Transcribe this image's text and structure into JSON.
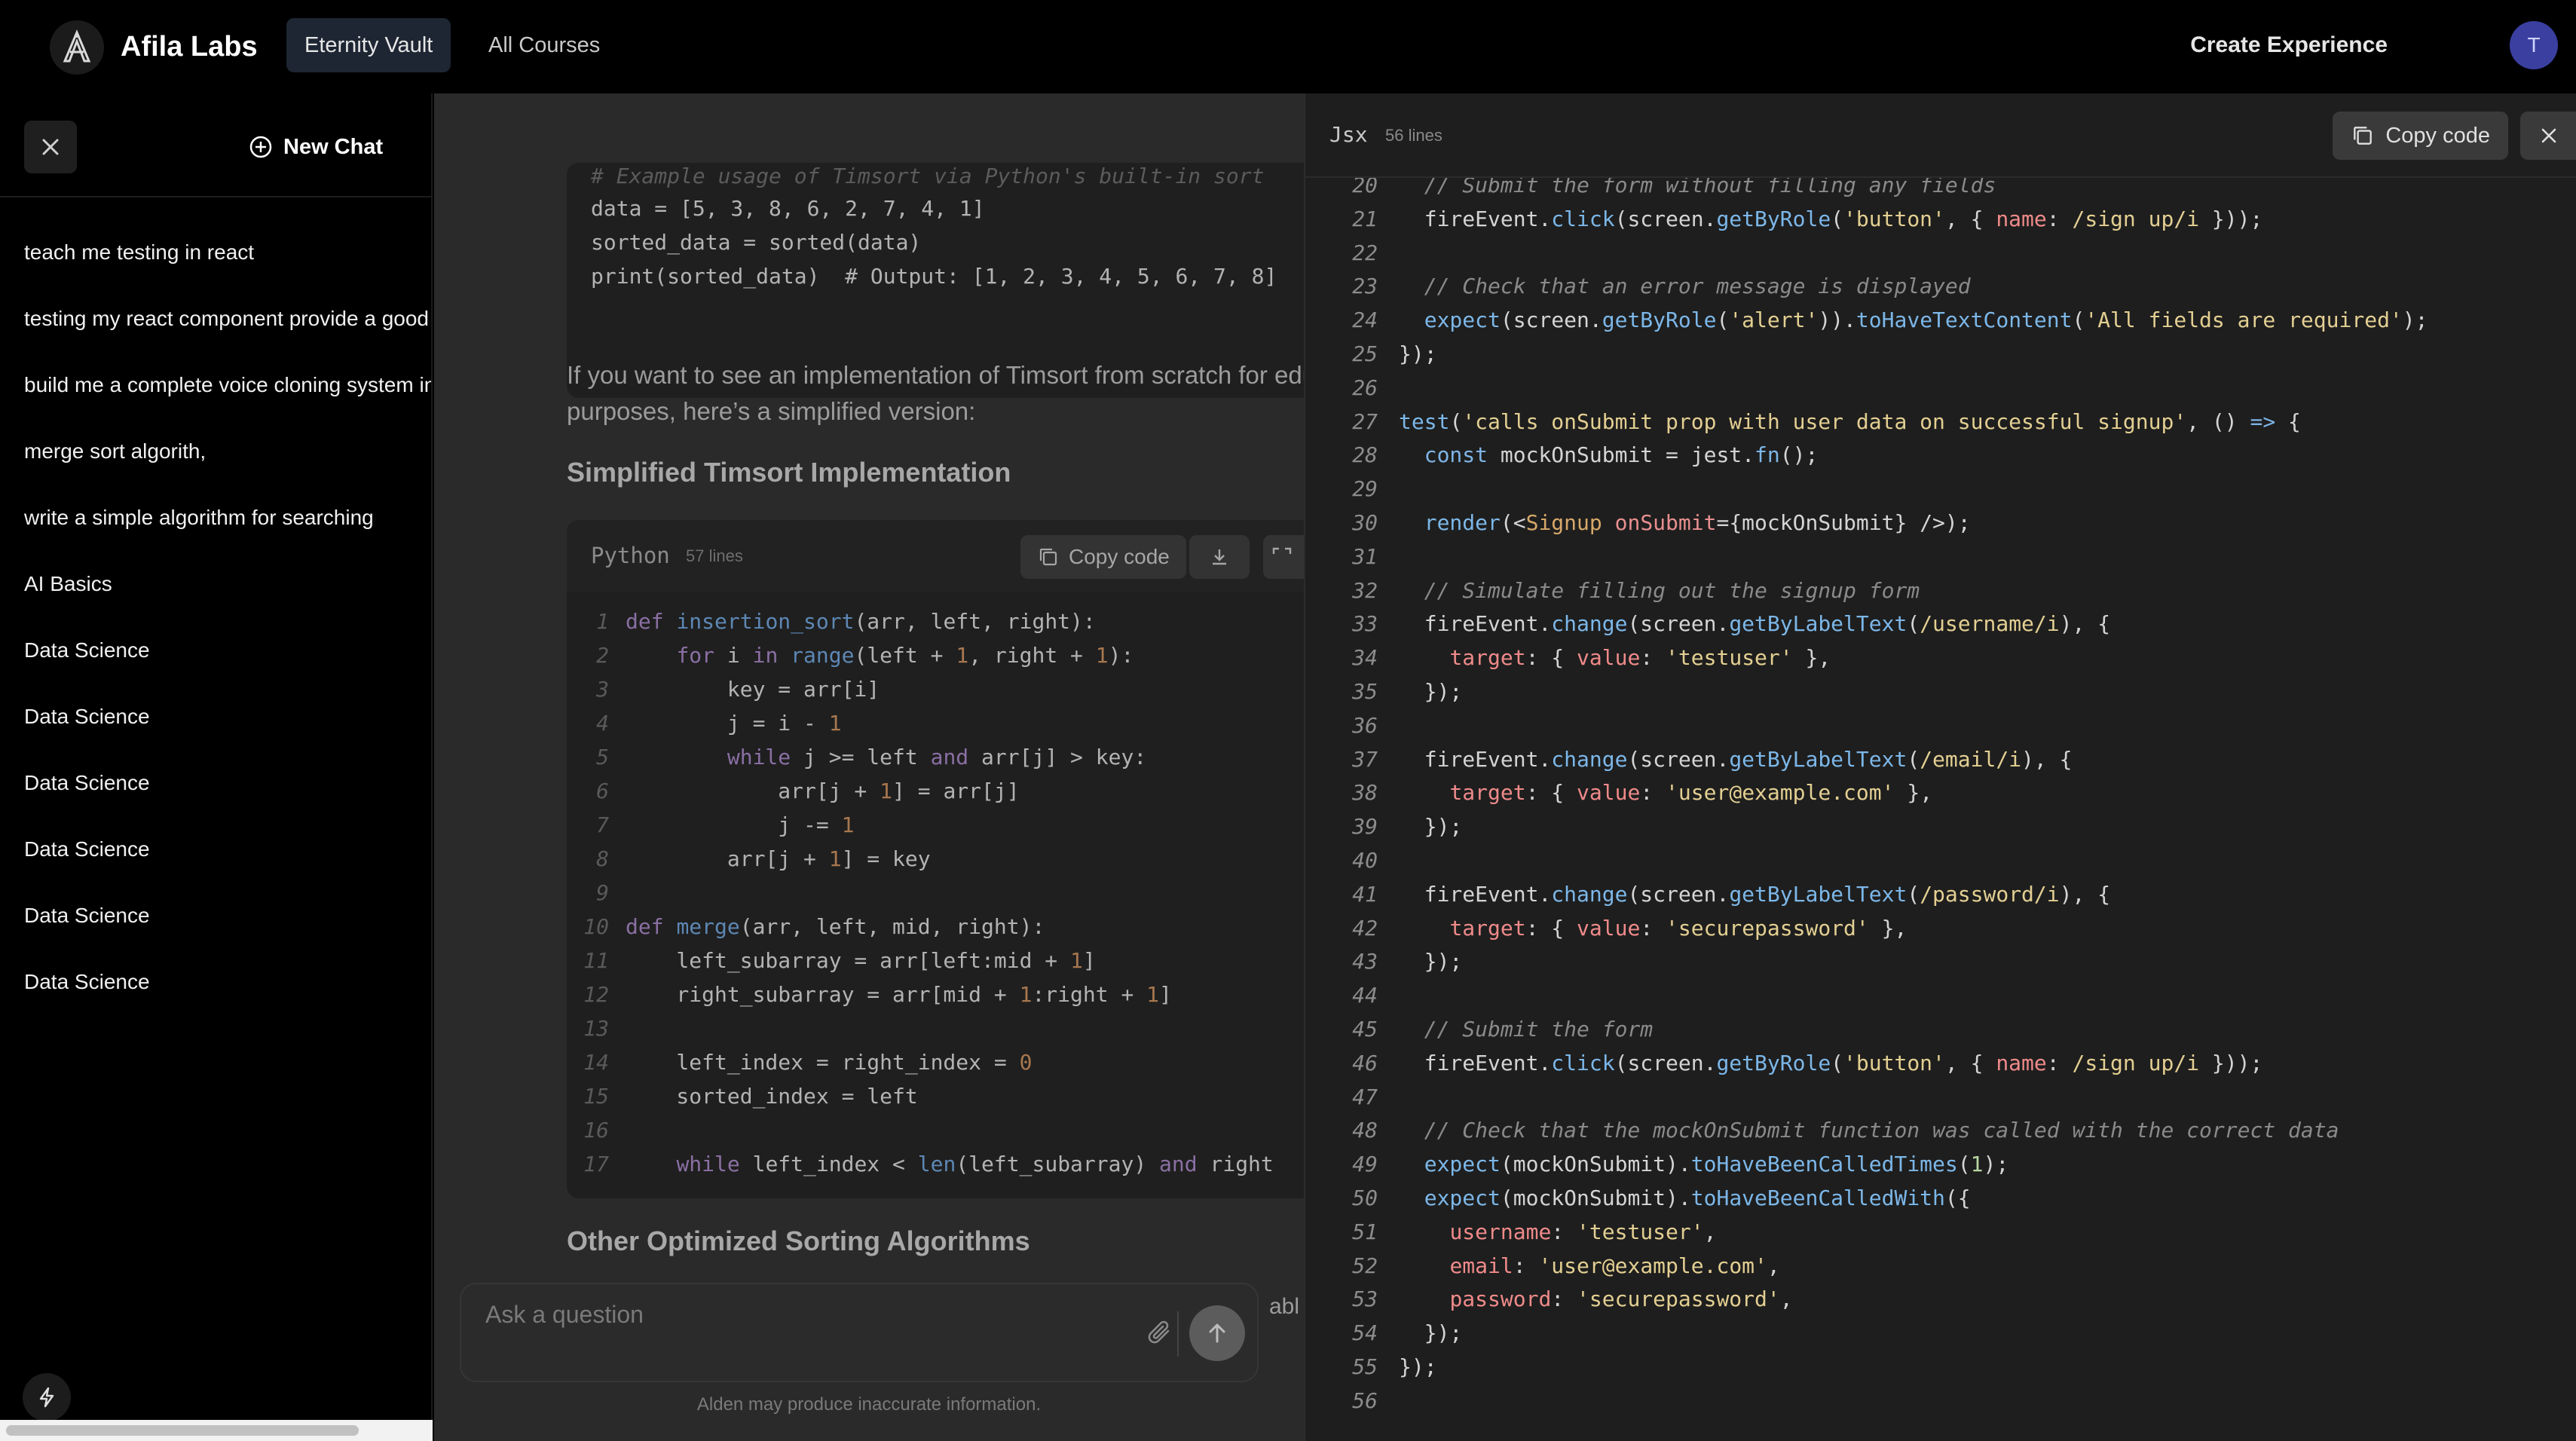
{
  "app": {
    "brand": "Afila Labs",
    "nav_tabs": [
      {
        "label": "Eternity Vault",
        "active": true
      },
      {
        "label": "All Courses",
        "active": false
      }
    ],
    "create_experience": "Create Experience",
    "avatar_initial": "T"
  },
  "sidebar": {
    "new_chat_label": "New Chat",
    "chats": [
      "teach me testing in react",
      "testing my react component provide a good",
      "build me a complete voice cloning system in",
      "merge sort algorith,",
      "write a simple algorithm for searching",
      "AI Basics",
      "Data Science",
      "Data Science",
      "Data Science",
      "Data Science",
      "Data Science",
      "Data Science"
    ]
  },
  "chat": {
    "top_code": {
      "lines": [
        "# Example usage of Timsort via Python's built-in sort",
        "data = [5, 3, 8, 6, 2, 7, 4, 1]",
        "sorted_data = sorted(data)",
        "print(sorted_data)  # Output: [1, 2, 3, 4, 5, 6, 7, 8]"
      ]
    },
    "paragraph_line1": "If you want to see an implementation of Timsort from scratch for educ",
    "paragraph_line2": "purposes, here’s a simplified version:",
    "heading_1": "Simplified Timsort Implementation",
    "code_block": {
      "language": "Python",
      "line_count": "57 lines",
      "copy_label": "Copy code",
      "lines": [
        "def insertion_sort(arr, left, right):",
        "    for i in range(left + 1, right + 1):",
        "        key = arr[i]",
        "        j = i - 1",
        "        while j >= left and arr[j] > key:",
        "            arr[j + 1] = arr[j]",
        "            j -= 1",
        "        arr[j + 1] = key",
        "",
        "def merge(arr, left, mid, right):",
        "    left_subarray = arr[left:mid + 1]",
        "    right_subarray = arr[mid + 1:right + 1]",
        "",
        "    left_index = right_index = 0",
        "    sorted_index = left",
        "",
        "    while left_index < len(left_subarray) and right"
      ]
    },
    "heading_2": "Other Optimized Sorting Algorithms",
    "trailing_text": "abl",
    "input_placeholder": "Ask a question",
    "disclaimer": "Alden may produce inaccurate information."
  },
  "code_panel": {
    "language": "Jsx",
    "line_count": "56 lines",
    "copy_label": "Copy code",
    "first_line_number": 20,
    "lines": [
      "  // Submit the form without filling any fields",
      "  fireEvent.click(screen.getByRole('button', { name: /sign up/i }));",
      "",
      "  // Check that an error message is displayed",
      "  expect(screen.getByRole('alert')).toHaveTextContent('All fields are required');",
      "});",
      "",
      "test('calls onSubmit prop with user data on successful signup', () => {",
      "  const mockOnSubmit = jest.fn();",
      "",
      "  render(<Signup onSubmit={mockOnSubmit} />);",
      "",
      "  // Simulate filling out the signup form",
      "  fireEvent.change(screen.getByLabelText(/username/i), {",
      "    target: { value: 'testuser' },",
      "  });",
      "",
      "  fireEvent.change(screen.getByLabelText(/email/i), {",
      "    target: { value: 'user@example.com' },",
      "  });",
      "",
      "  fireEvent.change(screen.getByLabelText(/password/i), {",
      "    target: { value: 'securepassword' },",
      "  });",
      "",
      "  // Submit the form",
      "  fireEvent.click(screen.getByRole('button', { name: /sign up/i }));",
      "",
      "  // Check that the mockOnSubmit function was called with the correct data",
      "  expect(mockOnSubmit).toHaveBeenCalledTimes(1);",
      "  expect(mockOnSubmit).toHaveBeenCalledWith({",
      "    username: 'testuser',",
      "    email: 'user@example.com',",
      "    password: 'securepassword',",
      "  });",
      "});",
      ""
    ]
  }
}
